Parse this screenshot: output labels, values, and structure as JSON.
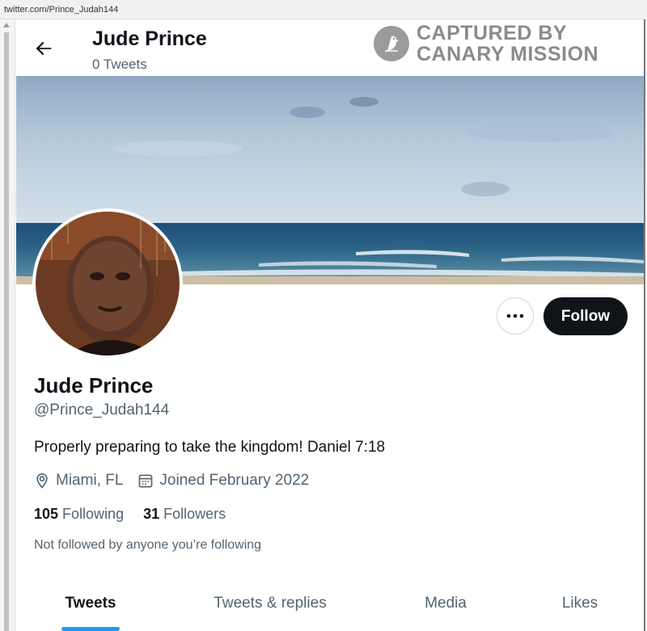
{
  "browser": {
    "url": "twitter.com/Prince_Judah144"
  },
  "header": {
    "name": "Jude Prince",
    "tweet_count": "0 Tweets"
  },
  "watermark": {
    "line1": "CAPTURED BY",
    "line2": "CANARY MISSION"
  },
  "profile": {
    "display_name": "Jude Prince",
    "handle": "@Prince_Judah144",
    "bio": "Properly preparing to take the kingdom! Daniel 7:18",
    "location": "Miami, FL",
    "joined": "Joined February 2022",
    "following_count": "105",
    "following_label": "Following",
    "followers_count": "31",
    "followers_label": "Followers",
    "not_followed_text": "Not followed by anyone you’re following"
  },
  "actions": {
    "more_label": "More",
    "follow_label": "Follow"
  },
  "tabs": [
    {
      "label": "Tweets",
      "active": true
    },
    {
      "label": "Tweets & replies",
      "active": false
    },
    {
      "label": "Media",
      "active": false
    },
    {
      "label": "Likes",
      "active": false
    }
  ],
  "colors": {
    "accent": "#1d9bf0",
    "text_primary": "#0f1419",
    "text_secondary": "#536471",
    "follow_button_bg": "#0f1419"
  },
  "icons": {
    "back": "arrow-left-icon",
    "more": "ellipsis-icon",
    "location": "map-pin-icon",
    "calendar": "calendar-icon",
    "watermark_logo": "canary-bird-icon"
  }
}
